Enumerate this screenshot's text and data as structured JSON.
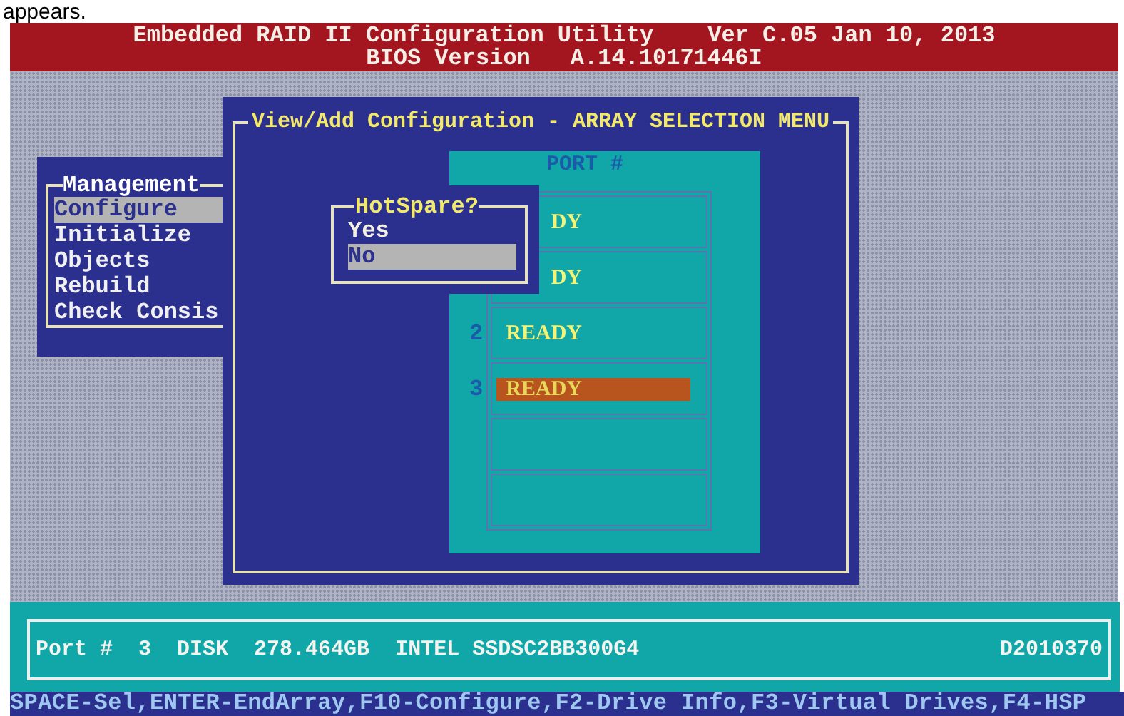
{
  "caption": "appears.",
  "header": {
    "title": "Embedded RAID II Configuration Utility",
    "version": "Ver C.05 Jan 10, 2013",
    "bios_label": "BIOS Version",
    "bios_version": "A.14.10171446I"
  },
  "management": {
    "title": "Management",
    "items": [
      {
        "label": "Configure",
        "selected": true
      },
      {
        "label": "Initialize",
        "selected": false
      },
      {
        "label": "Objects",
        "selected": false
      },
      {
        "label": "Rebuild",
        "selected": false
      },
      {
        "label": "Check Consis",
        "selected": false
      }
    ]
  },
  "dialog": {
    "title": "View/Add Configuration - ARRAY SELECTION MENU",
    "port_header": "PORT #",
    "ports": [
      {
        "status": "DY",
        "selected": false
      },
      {
        "status": "DY",
        "selected": false
      },
      {
        "number": "2",
        "status": "READY",
        "selected": false
      },
      {
        "number": "3",
        "status": "READY",
        "selected": true
      },
      {
        "selected": false
      },
      {
        "selected": false
      }
    ]
  },
  "hotspare": {
    "title": "HotSpare?",
    "options": [
      {
        "label": "Yes",
        "selected": false
      },
      {
        "label": "No",
        "selected": true
      }
    ]
  },
  "info_bar": {
    "port_label": "Port #",
    "port": "3",
    "type": "DISK",
    "size": "278.464GB",
    "model": "INTEL SSDSC2BB300G4",
    "serial": "D2010370"
  },
  "footer": "SPACE-Sel,ENTER-EndArray,F10-Configure,F2-Drive Info,F3-Virtual Drives,F4-HSP"
}
